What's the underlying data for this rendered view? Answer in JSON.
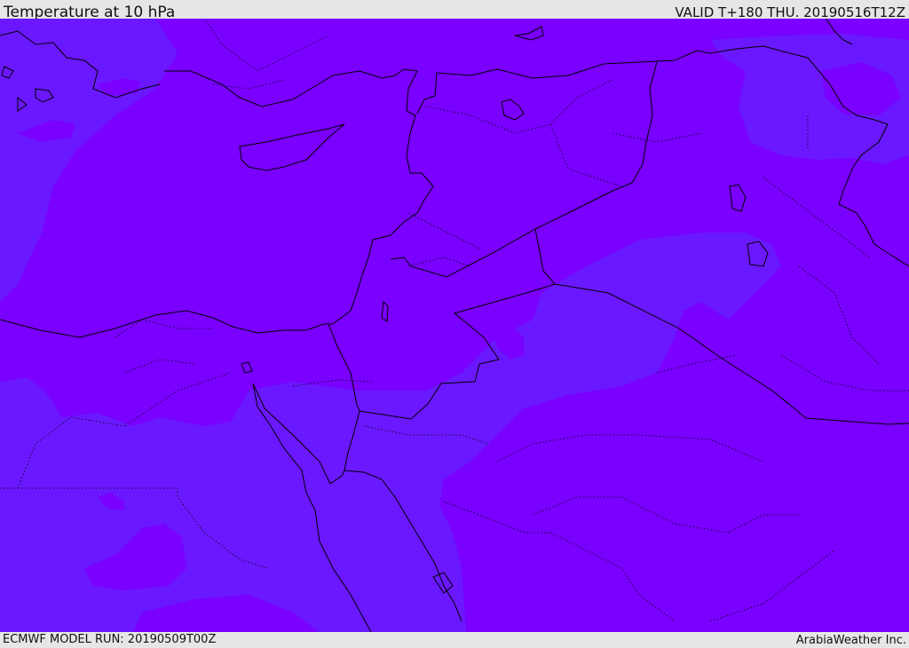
{
  "header": {
    "title": "Temperature at 10 hPa",
    "valid": "VALID T+180 THU. 20190516T12Z"
  },
  "footer": {
    "model_run": "ECMWF MODEL RUN: 20190509T00Z",
    "credit": "ArabiaWeather Inc."
  },
  "map": {
    "colors": {
      "warmer_field": "#7a00ff",
      "cooler_field": "#6a18ff",
      "borders": "#000000"
    }
  }
}
